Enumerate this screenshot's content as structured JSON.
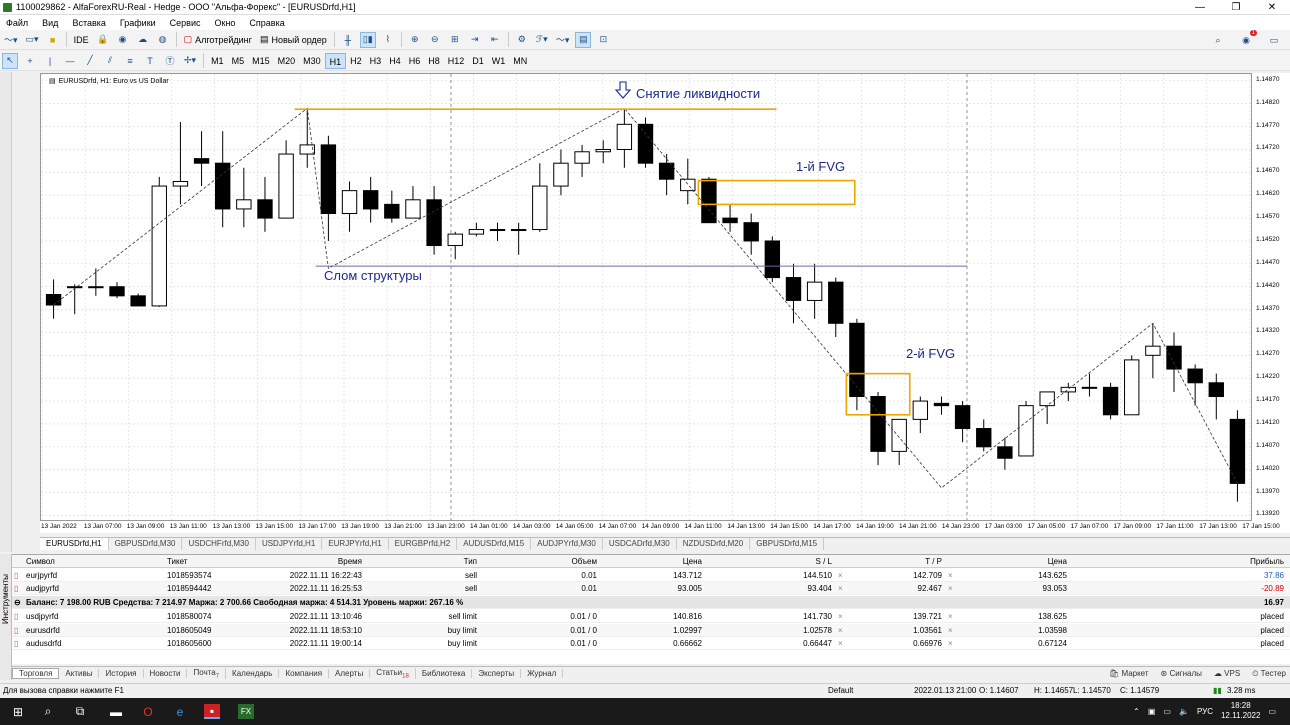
{
  "window": {
    "title": "1100029862 - AlfaForexRU-Real - Hedge - ООО \"Альфа-Форекс\" - [EURUSDrfd,H1]"
  },
  "menu": [
    "Файл",
    "Вид",
    "Вставка",
    "Графики",
    "Сервис",
    "Окно",
    "Справка"
  ],
  "toolbar": {
    "ide": "IDE",
    "algotrading": "Алготрейдинг",
    "new_order": "Новый ордер",
    "timeframes": [
      "M1",
      "M5",
      "M15",
      "M20",
      "M30",
      "H1",
      "H2",
      "H3",
      "H4",
      "H6",
      "H8",
      "H12",
      "D1",
      "W1",
      "MN"
    ],
    "active_timeframe": "H1",
    "notification_count": "1"
  },
  "chart": {
    "header": "EURUSDrfd, H1:  Euro vs US Dollar",
    "annotations": {
      "liquidity": "Снятие ликвидности",
      "fvg1": "1-й FVG",
      "fvg2": "2-й FVG",
      "structure": "Слом структуры"
    },
    "colors": {
      "orange": "#f0a500",
      "navy": "#1a2a8a",
      "blue_line": "#6a6aa8"
    }
  },
  "chart_data": {
    "type": "candlestick",
    "symbol": "EURUSDrfd",
    "timeframe": "H1",
    "y_ticks": [
      "1.14870",
      "1.14820",
      "1.14770",
      "1.14720",
      "1.14670",
      "1.14620",
      "1.14570",
      "1.14520",
      "1.14470",
      "1.14420",
      "1.14370",
      "1.14320",
      "1.14270",
      "1.14220",
      "1.14170",
      "1.14120",
      "1.14070",
      "1.14020",
      "1.13970",
      "1.13920"
    ],
    "x_ticks": [
      "13 Jan 2022",
      "13 Jan 07:00",
      "13 Jan 09:00",
      "13 Jan 11:00",
      "13 Jan 13:00",
      "13 Jan 15:00",
      "13 Jan 17:00",
      "13 Jan 19:00",
      "13 Jan 21:00",
      "13 Jan 23:00",
      "14 Jan 01:00",
      "14 Jan 03:00",
      "14 Jan 05:00",
      "14 Jan 07:00",
      "14 Jan 09:00",
      "14 Jan 11:00",
      "14 Jan 13:00",
      "14 Jan 15:00",
      "14 Jan 17:00",
      "14 Jan 19:00",
      "14 Jan 21:00",
      "14 Jan 23:00",
      "17 Jan 03:00",
      "17 Jan 05:00",
      "17 Jan 07:00",
      "17 Jan 09:00",
      "17 Jan 11:00",
      "17 Jan 13:00",
      "17 Jan 15:00"
    ],
    "ylim": [
      1.1391,
      1.14885
    ],
    "candles": [
      [
        1.14403,
        1.14436,
        1.1435,
        1.1438
      ],
      [
        1.1442,
        1.14425,
        1.1436,
        1.1442
      ],
      [
        1.1442,
        1.1446,
        1.144,
        1.1442
      ],
      [
        1.1442,
        1.1443,
        1.14395,
        1.144
      ],
      [
        1.144,
        1.14405,
        1.1438,
        1.14378
      ],
      [
        1.14378,
        1.1466,
        1.14376,
        1.1464
      ],
      [
        1.1464,
        1.1478,
        1.146,
        1.1465
      ],
      [
        1.147,
        1.1476,
        1.1464,
        1.1469
      ],
      [
        1.1469,
        1.1476,
        1.1455,
        1.1459
      ],
      [
        1.1459,
        1.1468,
        1.1455,
        1.1461
      ],
      [
        1.1461,
        1.1466,
        1.1454,
        1.1457
      ],
      [
        1.1457,
        1.1474,
        1.1458,
        1.1471
      ],
      [
        1.1471,
        1.1481,
        1.1468,
        1.1473
      ],
      [
        1.1473,
        1.1475,
        1.1452,
        1.1458
      ],
      [
        1.1458,
        1.1465,
        1.1454,
        1.1463
      ],
      [
        1.1463,
        1.1466,
        1.1456,
        1.1459
      ],
      [
        1.146,
        1.1463,
        1.1456,
        1.1457
      ],
      [
        1.1457,
        1.1464,
        1.1457,
        1.1461
      ],
      [
        1.1461,
        1.1464,
        1.1449,
        1.1451
      ],
      [
        1.1451,
        1.1454,
        1.1448,
        1.14535
      ],
      [
        1.14535,
        1.1456,
        1.1453,
        1.14545
      ],
      [
        1.14545,
        1.1456,
        1.1452,
        1.14545
      ],
      [
        1.14545,
        1.1456,
        1.1449,
        1.14545
      ],
      [
        1.14545,
        1.1469,
        1.1454,
        1.1464
      ],
      [
        1.1464,
        1.1472,
        1.1462,
        1.1469
      ],
      [
        1.1469,
        1.1473,
        1.1466,
        1.14715
      ],
      [
        1.14715,
        1.1474,
        1.1469,
        1.1472
      ],
      [
        1.1472,
        1.1481,
        1.1468,
        1.14775
      ],
      [
        1.14775,
        1.1479,
        1.1468,
        1.1469
      ],
      [
        1.1469,
        1.1471,
        1.1462,
        1.14655
      ],
      [
        1.1463,
        1.147,
        1.146,
        1.14655
      ],
      [
        1.14655,
        1.1466,
        1.1456,
        1.1456
      ],
      [
        1.1457,
        1.146,
        1.1454,
        1.1456
      ],
      [
        1.1456,
        1.1458,
        1.1449,
        1.1452
      ],
      [
        1.1452,
        1.1453,
        1.1443,
        1.1444
      ],
      [
        1.1444,
        1.1447,
        1.1434,
        1.1439
      ],
      [
        1.1439,
        1.1447,
        1.1435,
        1.1443
      ],
      [
        1.1443,
        1.1444,
        1.1431,
        1.1434
      ],
      [
        1.1434,
        1.1435,
        1.1415,
        1.1418
      ],
      [
        1.1418,
        1.1419,
        1.1403,
        1.1406
      ],
      [
        1.1406,
        1.1413,
        1.1403,
        1.1413
      ],
      [
        1.1413,
        1.1418,
        1.141,
        1.1417
      ],
      [
        1.14165,
        1.1418,
        1.1414,
        1.1416
      ],
      [
        1.1416,
        1.1417,
        1.1408,
        1.1411
      ],
      [
        1.1411,
        1.1413,
        1.1406,
        1.1407
      ],
      [
        1.1407,
        1.1409,
        1.1402,
        1.14045
      ],
      [
        1.1405,
        1.1417,
        1.1405,
        1.1416
      ],
      [
        1.1416,
        1.1419,
        1.1412,
        1.1419
      ],
      [
        1.1419,
        1.1421,
        1.1417,
        1.142
      ],
      [
        1.142,
        1.1423,
        1.1418,
        1.142
      ],
      [
        1.142,
        1.1421,
        1.1413,
        1.1414
      ],
      [
        1.1414,
        1.1427,
        1.1414,
        1.1426
      ],
      [
        1.1427,
        1.1434,
        1.1422,
        1.1429
      ],
      [
        1.1429,
        1.1432,
        1.1419,
        1.1424
      ],
      [
        1.1424,
        1.1425,
        1.1416,
        1.1421
      ],
      [
        1.1421,
        1.1423,
        1.1413,
        1.1418
      ],
      [
        1.1413,
        1.1415,
        1.1395,
        1.1399
      ]
    ]
  },
  "chart_tabs": [
    "EURUSDrfd,H1",
    "GBPUSDrfd,M30",
    "USDCHFrfd,M30",
    "USDJPYrfd,H1",
    "EURJPYrfd,H1",
    "EURGBPrfd,H2",
    "AUDUSDrfd,M15",
    "AUDJPYrfd,M30",
    "USDCADrfd,M30",
    "NZDUSDrfd,M20",
    "GBPUSDrfd,M15"
  ],
  "terminal": {
    "side_label": "Инструменты",
    "headers": [
      "Символ",
      "Тикет",
      "Время",
      "Тип",
      "Объем",
      "Цена",
      "S / L",
      "T / P",
      "Цена",
      "Прибыль"
    ],
    "positions": [
      [
        "eurjpyrfd",
        "1018593574",
        "2022.11.11 16:22:43",
        "sell",
        "0.01",
        "143.712",
        "144.510",
        "142.709",
        "143.625",
        "37.86"
      ],
      [
        "audjpyrfd",
        "1018594442",
        "2022.11.11 16:25:53",
        "sell",
        "0.01",
        "93.005",
        "93.404",
        "92.467",
        "93.053",
        "-20.89"
      ]
    ],
    "balance": "Баланс: 7 198.00 RUB  Средства: 7 214.97  Маржа: 2 700.66  Свободная маржа: 4 514.31  Уровень маржи: 267.16 %",
    "balance_profit": "16.97",
    "orders": [
      [
        "usdjpyrfd",
        "1018580074",
        "2022.11.11 13:10:46",
        "sell limit",
        "0.01 / 0",
        "140.816",
        "141.730",
        "139.721",
        "138.625",
        "placed"
      ],
      [
        "eurusdrfd",
        "1018605049",
        "2022.11.11 18:53:10",
        "buy limit",
        "0.01 / 0",
        "1.02997",
        "1.02578",
        "1.03561",
        "1.03598",
        "placed"
      ],
      [
        "audusdrfd",
        "1018605600",
        "2022.11.11 19:00:14",
        "buy limit",
        "0.01 / 0",
        "0.66662",
        "0.66447",
        "0.66976",
        "0.67124",
        "placed"
      ]
    ]
  },
  "bottom_tabs": [
    {
      "label": "Торговля",
      "badge": ""
    },
    {
      "label": "Активы",
      "badge": ""
    },
    {
      "label": "История",
      "badge": ""
    },
    {
      "label": "Новости",
      "badge": ""
    },
    {
      "label": "Почта",
      "badge": "7"
    },
    {
      "label": "Календарь",
      "badge": ""
    },
    {
      "label": "Компания",
      "badge": ""
    },
    {
      "label": "Алерты",
      "badge": ""
    },
    {
      "label": "Статьи",
      "badge": "18"
    },
    {
      "label": "Библиотека",
      "badge": ""
    },
    {
      "label": "Эксперты",
      "badge": ""
    },
    {
      "label": "Журнал",
      "badge": ""
    }
  ],
  "bottom_right": [
    "Маркет",
    "Сигналы",
    "VPS",
    "Тестер"
  ],
  "status": {
    "help": "Для вызова справки нажмите F1",
    "profile": "Default",
    "datetime": "2022.01.13 21:00",
    "open": "O: 1.14607",
    "high": "H: 1.14657",
    "low": "L: 1.14570",
    "close": "C: 1.14579",
    "ping": "3.28 ms"
  },
  "taskbar": {
    "lang": "РУС",
    "time": "18:28",
    "date": "12.11.2022"
  }
}
